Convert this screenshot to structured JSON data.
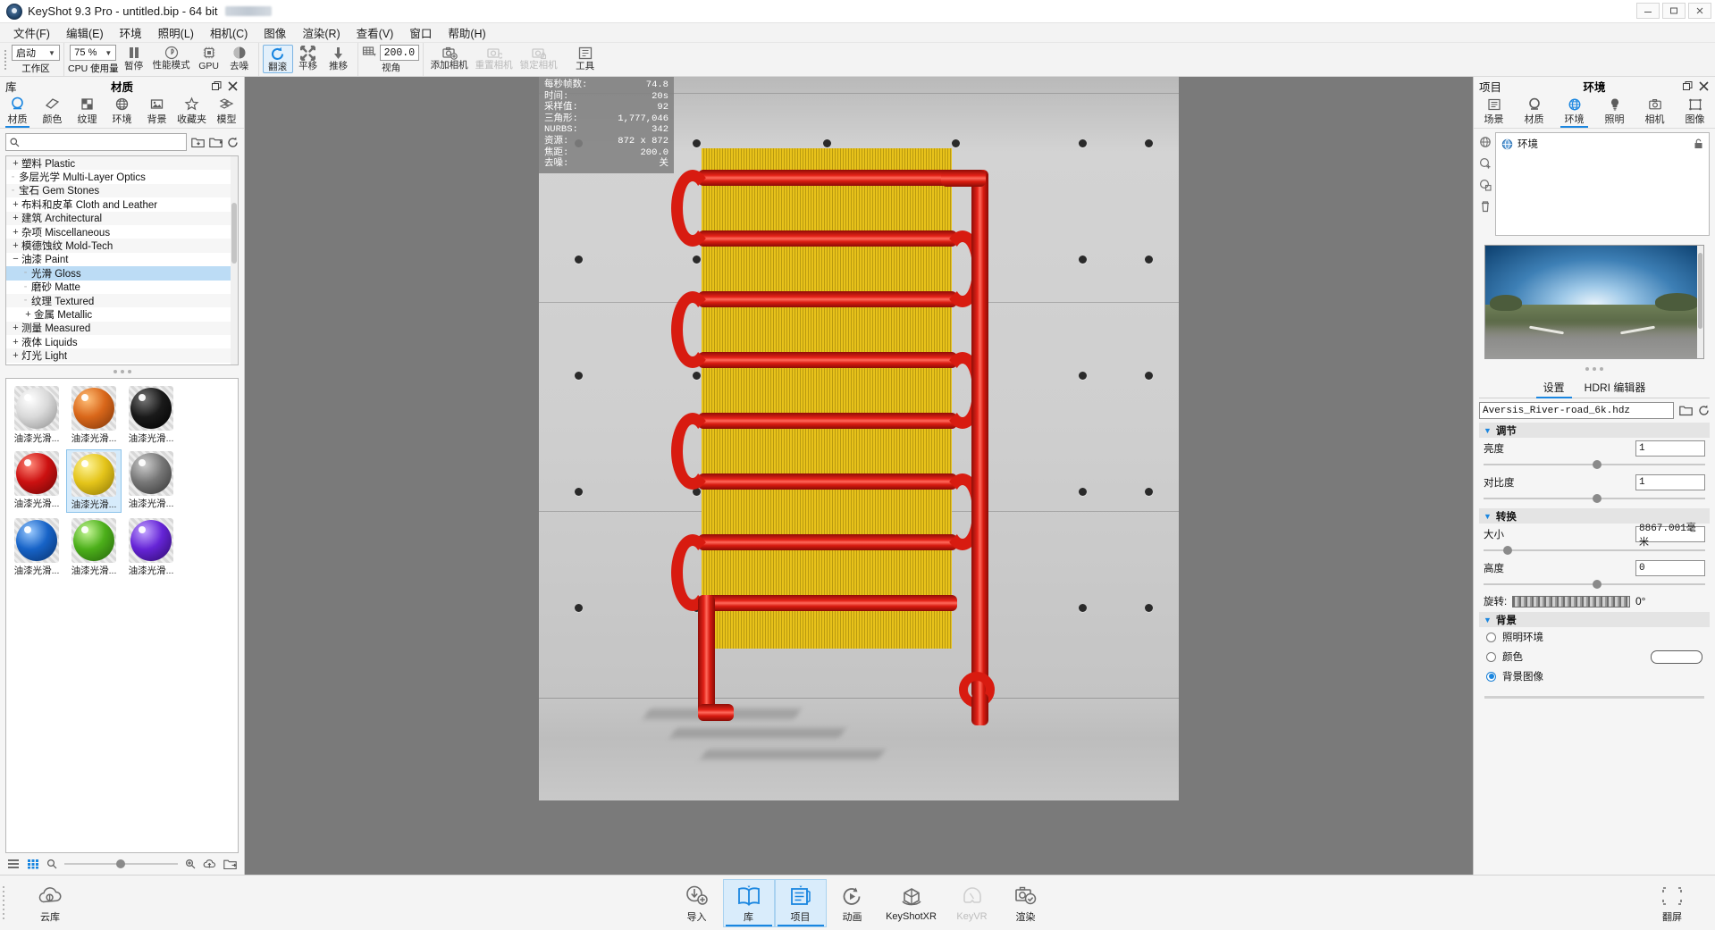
{
  "window": {
    "title": "KeyShot 9.3 Pro  - untitled.bip  - 64 bit",
    "minimize": "—",
    "maximize": "▭",
    "close": "✕"
  },
  "menu": {
    "items": [
      {
        "label": "文件(F)"
      },
      {
        "label": "编辑(E)"
      },
      {
        "label": "环境"
      },
      {
        "label": "照明(L)"
      },
      {
        "label": "相机(C)"
      },
      {
        "label": "图像"
      },
      {
        "label": "渲染(R)"
      },
      {
        "label": "查看(V)"
      },
      {
        "label": "窗口"
      },
      {
        "label": "帮助(H)"
      }
    ]
  },
  "toolbar": {
    "workspace": {
      "label": "工作区",
      "value": "启动"
    },
    "cpu_usage": {
      "label": "CPU 使用量",
      "value": "75 %"
    },
    "pause": {
      "label": "暂停",
      "icon": "pause-icon"
    },
    "performance_mode": {
      "label": "性能模式",
      "icon": "performance-icon"
    },
    "gpu": {
      "label": "GPU",
      "icon": "gpu-chip-icon"
    },
    "denoise": {
      "label": "去噪",
      "icon": "denoise-icon"
    },
    "tumble": {
      "label": "翻滚",
      "icon": "tumble-icon",
      "selected": true
    },
    "pan": {
      "label": "平移",
      "icon": "pan-icon"
    },
    "dolly": {
      "label": "推移",
      "icon": "dolly-icon"
    },
    "fov": {
      "label": "视角",
      "value": "200.0",
      "icon": "fov-grid-icon"
    },
    "add_camera": {
      "label": "添加相机",
      "icon": "camera-add-icon"
    },
    "reset_camera": {
      "label": "重置相机",
      "icon": "camera-reset-icon",
      "disabled": true
    },
    "lock_camera": {
      "label": "锁定相机",
      "icon": "camera-lock-icon",
      "disabled": true
    },
    "tools": {
      "label": "工具",
      "icon": "tools-icon"
    }
  },
  "library": {
    "panel_label": "库",
    "panel_title": "材质",
    "restore_icon": "restore-icon",
    "close_icon": "close-icon",
    "tabs": [
      {
        "label": "材质",
        "icon": "material-ball-icon",
        "active": true
      },
      {
        "label": "颜色",
        "icon": "color-swatch-icon",
        "active": false
      },
      {
        "label": "纹理",
        "icon": "texture-checker-icon",
        "active": false
      },
      {
        "label": "环境",
        "icon": "environment-globe-icon",
        "active": false
      },
      {
        "label": "背景",
        "icon": "background-image-icon",
        "active": false
      },
      {
        "label": "收藏夹",
        "icon": "star-icon",
        "active": false
      },
      {
        "label": "模型",
        "icon": "model-cubes-icon",
        "active": false
      }
    ],
    "search": {
      "placeholder": "",
      "value": "",
      "icon": "search-icon"
    },
    "search_tools": [
      {
        "icon": "folder-import-icon"
      },
      {
        "icon": "folder-open-icon"
      },
      {
        "icon": "refresh-icon"
      }
    ],
    "tree": [
      {
        "label": "塑料 Plastic",
        "expander": "+",
        "depth": 0
      },
      {
        "label": "多层光学 Multi-Layer Optics",
        "expander": "",
        "depth": 0,
        "leaf": true
      },
      {
        "label": "宝石 Gem Stones",
        "expander": "",
        "depth": 0,
        "leaf": true
      },
      {
        "label": "布料和皮革 Cloth and Leather",
        "expander": "+",
        "depth": 0
      },
      {
        "label": "建筑 Architectural",
        "expander": "+",
        "depth": 0
      },
      {
        "label": "杂项 Miscellaneous",
        "expander": "+",
        "depth": 0
      },
      {
        "label": "模德蚀纹 Mold-Tech",
        "expander": "+",
        "depth": 0
      },
      {
        "label": "油漆 Paint",
        "expander": "−",
        "depth": 0
      },
      {
        "label": "光滑 Gloss",
        "expander": "",
        "depth": 1,
        "leaf": true,
        "selected": true
      },
      {
        "label": "磨砂 Matte",
        "expander": "",
        "depth": 1,
        "leaf": true
      },
      {
        "label": "纹理 Textured",
        "expander": "",
        "depth": 1,
        "leaf": true
      },
      {
        "label": "金属 Metallic",
        "expander": "+",
        "depth": 1
      },
      {
        "label": "测量 Measured",
        "expander": "+",
        "depth": 0
      },
      {
        "label": "液体 Liquids",
        "expander": "+",
        "depth": 0
      },
      {
        "label": "灯光 Light",
        "expander": "+",
        "depth": 0
      }
    ],
    "materials": [
      {
        "label": "油漆光滑...",
        "color": "#d9d9d9",
        "selected": false
      },
      {
        "label": "油漆光滑...",
        "color": "#d9671a",
        "selected": false
      },
      {
        "label": "油漆光滑...",
        "color": "#1a1a1a",
        "selected": false
      },
      {
        "label": "油漆光滑...",
        "color": "#cc1111",
        "selected": false
      },
      {
        "label": "油漆光滑...",
        "color": "#e4c41a",
        "selected": true
      },
      {
        "label": "油漆光滑...",
        "color": "#777777",
        "selected": false
      },
      {
        "label": "油漆光滑...",
        "color": "#1763c7",
        "selected": false
      },
      {
        "label": "油漆光滑...",
        "color": "#4caf1a",
        "selected": false
      },
      {
        "label": "油漆光滑...",
        "color": "#6524d6",
        "selected": false
      }
    ],
    "footer": {
      "list_view_icon": "list-view-icon",
      "grid_view_icon": "grid-view-icon",
      "zoom_out_icon": "zoom-out-icon",
      "zoom_in_icon": "zoom-in-icon",
      "cloud_upload_icon": "cloud-upload-icon",
      "folder_export_icon": "folder-export-icon"
    }
  },
  "viewport": {
    "stats": [
      {
        "key": "每秒帧数:",
        "value": "74.8"
      },
      {
        "key": "时间:",
        "value": "20s"
      },
      {
        "key": "采样值:",
        "value": "92"
      },
      {
        "key": "三角形:",
        "value": "1,777,046"
      },
      {
        "key": "NURBS:",
        "value": "342"
      },
      {
        "key": "资源:",
        "value": "872 x 872"
      },
      {
        "key": "焦距:",
        "value": "200.0"
      },
      {
        "key": "去噪:",
        "value": "关"
      }
    ]
  },
  "project": {
    "panel_label": "项目",
    "panel_title": "环境",
    "restore_icon": "restore-icon",
    "close_icon": "close-icon",
    "tabs": [
      {
        "label": "场景",
        "icon": "scene-list-icon",
        "active": false
      },
      {
        "label": "材质",
        "icon": "material-ball-icon",
        "active": false
      },
      {
        "label": "环境",
        "icon": "environment-globe-icon",
        "active": true
      },
      {
        "label": "照明",
        "icon": "lightbulb-icon",
        "active": false
      },
      {
        "label": "相机",
        "icon": "camera-icon",
        "active": false
      },
      {
        "label": "图像",
        "icon": "image-frame-icon",
        "active": false
      }
    ],
    "side_tools": [
      {
        "icon": "environment-globe-icon"
      },
      {
        "icon": "environment-add-icon"
      },
      {
        "icon": "environment-duplicate-icon"
      },
      {
        "icon": "trash-icon"
      }
    ],
    "env_list": [
      {
        "label": "环境",
        "icon": "environment-globe-icon",
        "lock_icon": "lock-icon"
      }
    ],
    "settings_tabs": [
      {
        "label": "设置",
        "active": true
      },
      {
        "label": "HDRI 编辑器",
        "active": false
      }
    ],
    "hdri_file": {
      "value": "Aversis_River-road_6k.hdz",
      "open_icon": "folder-open-icon",
      "reload_icon": "refresh-icon"
    },
    "adjust": {
      "title": "调节",
      "caret": "⌄",
      "controls": [
        {
          "label": "亮度",
          "value": "1",
          "slider_pct": 49
        },
        {
          "label": "对比度",
          "value": "1",
          "slider_pct": 49
        }
      ]
    },
    "transform": {
      "title": "转换",
      "caret": "⌄",
      "controls": [
        {
          "label": "大小",
          "value": "8867.001毫米",
          "slider_pct": 10
        },
        {
          "label": "高度",
          "value": "0",
          "slider_pct": 49
        }
      ],
      "rotation": {
        "label": "旋转:",
        "value": "0°"
      }
    },
    "background": {
      "title": "背景",
      "caret": "⌄",
      "options": [
        {
          "label": "照明环境",
          "selected": false
        },
        {
          "label": "颜色",
          "selected": false,
          "swatch": "#ffffff"
        },
        {
          "label": "背景图像",
          "selected": true
        }
      ]
    }
  },
  "bottombar": {
    "cloud": {
      "label": "云库",
      "icon": "cloud-library-icon"
    },
    "items": [
      {
        "label": "导入",
        "icon": "import-icon",
        "active": false,
        "disabled": false
      },
      {
        "label": "库",
        "icon": "library-book-icon",
        "active": true,
        "disabled": false
      },
      {
        "label": "项目",
        "icon": "project-list-icon",
        "active": true,
        "disabled": false
      },
      {
        "label": "动画",
        "icon": "animation-icon",
        "active": false,
        "disabled": false
      },
      {
        "label": "KeyShotXR",
        "icon": "keyshotxr-icon",
        "active": false,
        "disabled": false
      },
      {
        "label": "KeyVR",
        "icon": "keyvr-icon",
        "active": false,
        "disabled": true
      },
      {
        "label": "渲染",
        "icon": "render-icon",
        "active": false,
        "disabled": false
      }
    ],
    "fullscreen": {
      "label": "翻屏",
      "icon": "fullscreen-icon"
    }
  },
  "colors": {
    "accent": "#1a86e0",
    "selection": "#bcdcf5",
    "panel_bg": "#f5f5f5",
    "viewport_bg": "#7a7a7a"
  }
}
